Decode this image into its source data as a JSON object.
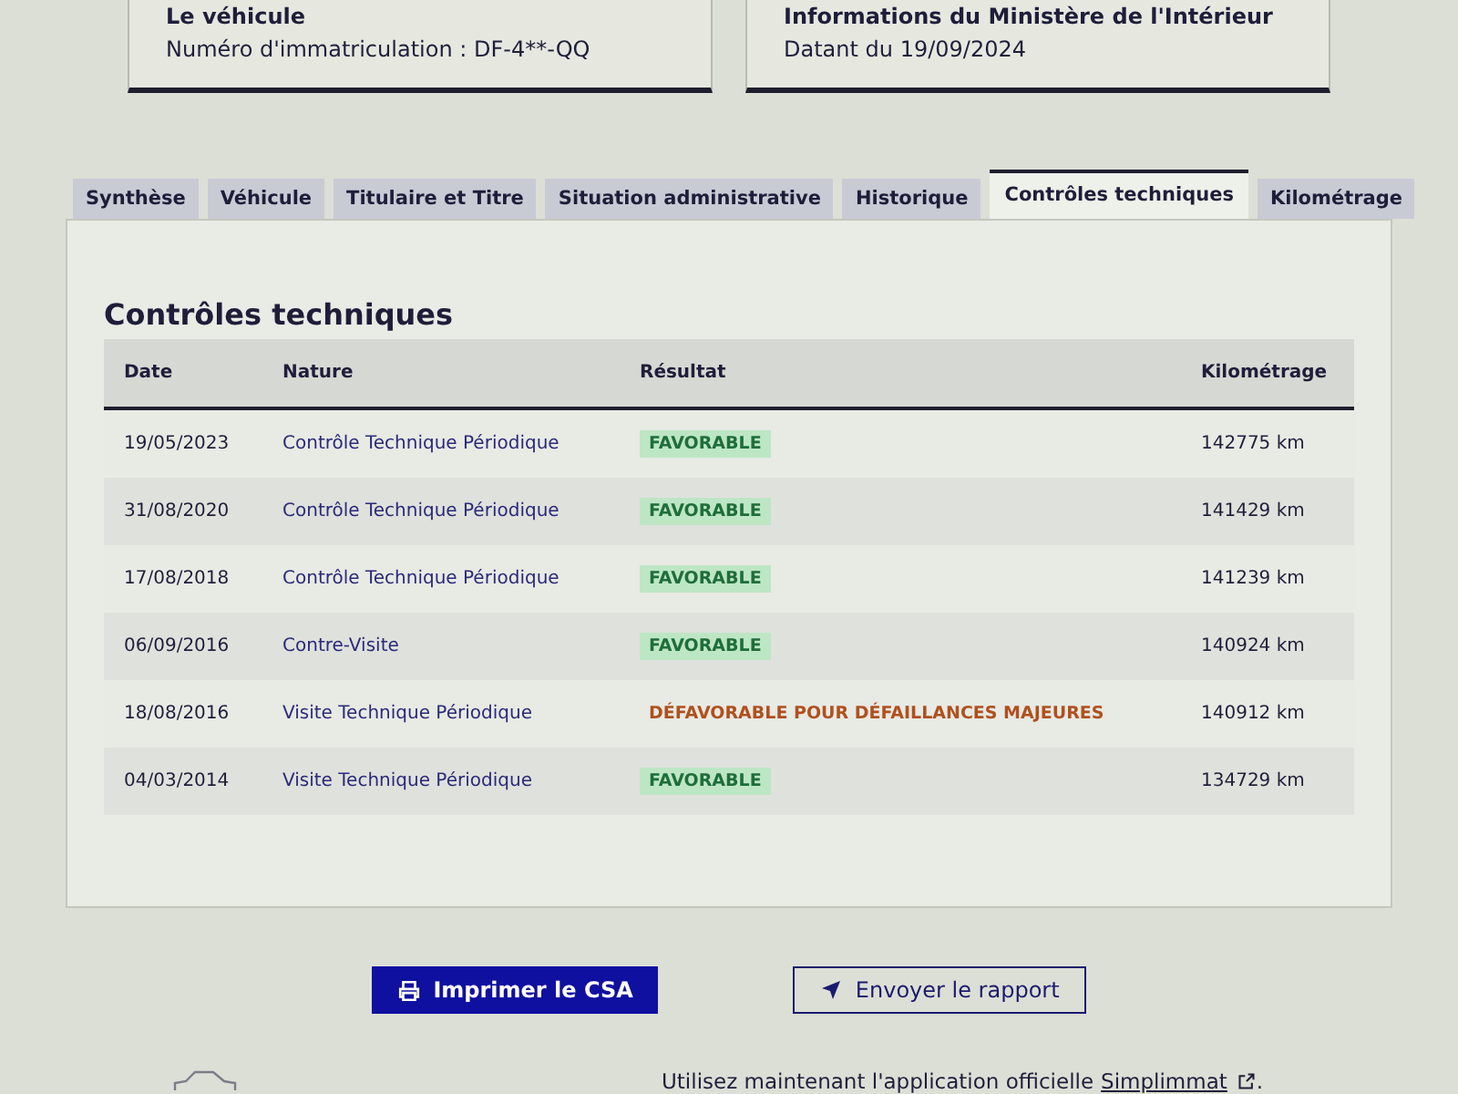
{
  "cards": [
    {
      "title": "Le véhicule",
      "text": "Numéro d'immatriculation : DF-4**-QQ"
    },
    {
      "title": "Informations du Ministère de l'Intérieur",
      "text": "Datant du 19/09/2024"
    }
  ],
  "tabs": [
    {
      "label": "Synthèse",
      "selected": false
    },
    {
      "label": "Véhicule",
      "selected": false
    },
    {
      "label": "Titulaire et Titre",
      "selected": false
    },
    {
      "label": "Situation administrative",
      "selected": false
    },
    {
      "label": "Historique",
      "selected": false
    },
    {
      "label": "Contrôles techniques",
      "selected": true
    },
    {
      "label": "Kilométrage",
      "selected": false
    }
  ],
  "section_title": "Contrôles techniques",
  "table": {
    "columns": [
      "Date",
      "Nature",
      "Résultat",
      "Kilométrage"
    ],
    "rows": [
      {
        "date": "19/05/2023",
        "nature": "Contrôle Technique Périodique",
        "result": "FAVORABLE",
        "kind": "favorable",
        "km": "142775 km"
      },
      {
        "date": "31/08/2020",
        "nature": "Contrôle Technique Périodique",
        "result": "FAVORABLE",
        "kind": "favorable",
        "km": "141429 km"
      },
      {
        "date": "17/08/2018",
        "nature": "Contrôle Technique Périodique",
        "result": "FAVORABLE",
        "kind": "favorable",
        "km": "141239 km"
      },
      {
        "date": "06/09/2016",
        "nature": "Contre-Visite",
        "result": "FAVORABLE",
        "kind": "favorable",
        "km": "140924 km"
      },
      {
        "date": "18/08/2016",
        "nature": "Visite Technique Périodique",
        "result": "DÉFAVORABLE POUR DÉFAILLANCES MAJEURES",
        "kind": "unfavorable",
        "km": "140912 km"
      },
      {
        "date": "04/03/2014",
        "nature": "Visite Technique Périodique",
        "result": "FAVORABLE",
        "kind": "favorable",
        "km": "134729 km"
      }
    ]
  },
  "buttons": {
    "print": "Imprimer le CSA",
    "send": "Envoyer le rapport"
  },
  "footer": {
    "text": "Utilisez maintenant l'application officielle",
    "link": "Simplimmat",
    "end": "."
  }
}
